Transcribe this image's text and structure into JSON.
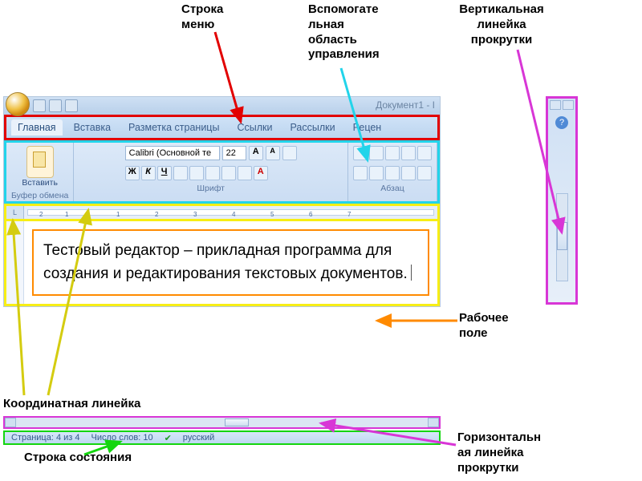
{
  "labels": {
    "menu_row": "Строка\nменю",
    "ribbon_area": "Вспомогате\nльная\nобласть\nуправления",
    "v_scrollbar": "Вертикальная\nлинейка\nпрокрутки",
    "work_area": "Рабочее\nполе",
    "h_scrollbar": "Горизонтальн\nая линейка\nпрокрутки",
    "ruler": "Координатная линейка",
    "status_bar": "Строка состояния"
  },
  "titlebar": {
    "doc_title": "Документ1 - I"
  },
  "tabs": [
    "Главная",
    "Вставка",
    "Разметка страницы",
    "Ссылки",
    "Рассылки",
    "Рецен"
  ],
  "clipboard_group": {
    "paste": "Вставить",
    "label": "Буфер обмена"
  },
  "font_group": {
    "font_name": "Calibri (Основной те",
    "font_size": "22",
    "label": "Шрифт",
    "b": "Ж",
    "i": "К",
    "u": "Ч"
  },
  "para_group": {
    "label": "Абзац"
  },
  "ruler_corner": "L",
  "ruler_numbers": [
    "2",
    "1",
    "",
    "1",
    "2",
    "3",
    "4",
    "5",
    "6",
    "7"
  ],
  "document_text": "Тестовый редактор – прикладная программа для создания и редактирования текстовых документов.",
  "status": {
    "page": "Страница: 4 из 4",
    "words": "Число слов: 10",
    "lang": "русский"
  },
  "help_icon": "?"
}
